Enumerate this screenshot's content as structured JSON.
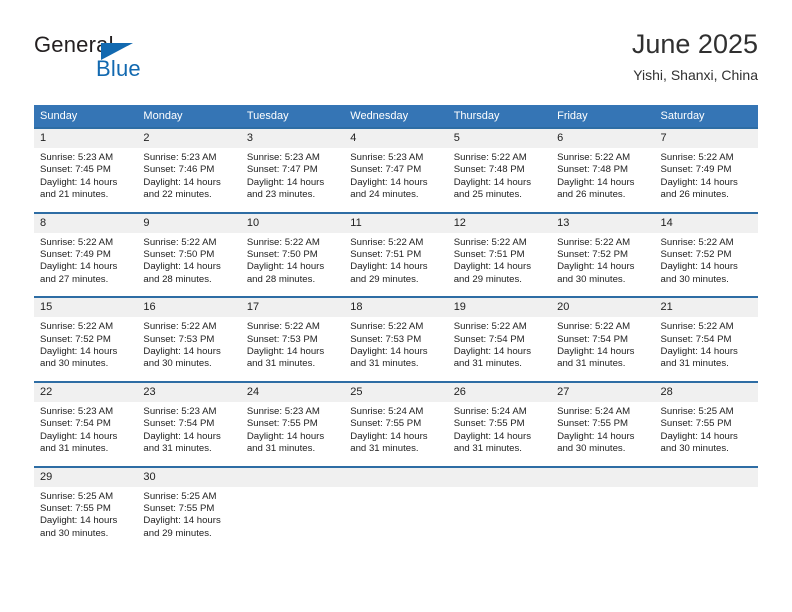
{
  "brand": {
    "name_top": "General",
    "name_bottom": "Blue",
    "triangle_color": "#1269b0"
  },
  "header": {
    "title": "June 2025",
    "location": "Yishi, Shanxi, China"
  },
  "colors": {
    "header_bg": "#3575b5",
    "header_text": "#ffffff",
    "daynum_bg": "#f0f0f0",
    "row_rule": "#2e6da4",
    "body_text": "#222222"
  },
  "weekday_headers": [
    "Sunday",
    "Monday",
    "Tuesday",
    "Wednesday",
    "Thursday",
    "Friday",
    "Saturday"
  ],
  "weeks": [
    [
      {
        "day": "1",
        "sunrise": "Sunrise: 5:23 AM",
        "sunset": "Sunset: 7:45 PM",
        "daylight1": "Daylight: 14 hours",
        "daylight2": "and 21 minutes."
      },
      {
        "day": "2",
        "sunrise": "Sunrise: 5:23 AM",
        "sunset": "Sunset: 7:46 PM",
        "daylight1": "Daylight: 14 hours",
        "daylight2": "and 22 minutes."
      },
      {
        "day": "3",
        "sunrise": "Sunrise: 5:23 AM",
        "sunset": "Sunset: 7:47 PM",
        "daylight1": "Daylight: 14 hours",
        "daylight2": "and 23 minutes."
      },
      {
        "day": "4",
        "sunrise": "Sunrise: 5:23 AM",
        "sunset": "Sunset: 7:47 PM",
        "daylight1": "Daylight: 14 hours",
        "daylight2": "and 24 minutes."
      },
      {
        "day": "5",
        "sunrise": "Sunrise: 5:22 AM",
        "sunset": "Sunset: 7:48 PM",
        "daylight1": "Daylight: 14 hours",
        "daylight2": "and 25 minutes."
      },
      {
        "day": "6",
        "sunrise": "Sunrise: 5:22 AM",
        "sunset": "Sunset: 7:48 PM",
        "daylight1": "Daylight: 14 hours",
        "daylight2": "and 26 minutes."
      },
      {
        "day": "7",
        "sunrise": "Sunrise: 5:22 AM",
        "sunset": "Sunset: 7:49 PM",
        "daylight1": "Daylight: 14 hours",
        "daylight2": "and 26 minutes."
      }
    ],
    [
      {
        "day": "8",
        "sunrise": "Sunrise: 5:22 AM",
        "sunset": "Sunset: 7:49 PM",
        "daylight1": "Daylight: 14 hours",
        "daylight2": "and 27 minutes."
      },
      {
        "day": "9",
        "sunrise": "Sunrise: 5:22 AM",
        "sunset": "Sunset: 7:50 PM",
        "daylight1": "Daylight: 14 hours",
        "daylight2": "and 28 minutes."
      },
      {
        "day": "10",
        "sunrise": "Sunrise: 5:22 AM",
        "sunset": "Sunset: 7:50 PM",
        "daylight1": "Daylight: 14 hours",
        "daylight2": "and 28 minutes."
      },
      {
        "day": "11",
        "sunrise": "Sunrise: 5:22 AM",
        "sunset": "Sunset: 7:51 PM",
        "daylight1": "Daylight: 14 hours",
        "daylight2": "and 29 minutes."
      },
      {
        "day": "12",
        "sunrise": "Sunrise: 5:22 AM",
        "sunset": "Sunset: 7:51 PM",
        "daylight1": "Daylight: 14 hours",
        "daylight2": "and 29 minutes."
      },
      {
        "day": "13",
        "sunrise": "Sunrise: 5:22 AM",
        "sunset": "Sunset: 7:52 PM",
        "daylight1": "Daylight: 14 hours",
        "daylight2": "and 30 minutes."
      },
      {
        "day": "14",
        "sunrise": "Sunrise: 5:22 AM",
        "sunset": "Sunset: 7:52 PM",
        "daylight1": "Daylight: 14 hours",
        "daylight2": "and 30 minutes."
      }
    ],
    [
      {
        "day": "15",
        "sunrise": "Sunrise: 5:22 AM",
        "sunset": "Sunset: 7:52 PM",
        "daylight1": "Daylight: 14 hours",
        "daylight2": "and 30 minutes."
      },
      {
        "day": "16",
        "sunrise": "Sunrise: 5:22 AM",
        "sunset": "Sunset: 7:53 PM",
        "daylight1": "Daylight: 14 hours",
        "daylight2": "and 30 minutes."
      },
      {
        "day": "17",
        "sunrise": "Sunrise: 5:22 AM",
        "sunset": "Sunset: 7:53 PM",
        "daylight1": "Daylight: 14 hours",
        "daylight2": "and 31 minutes."
      },
      {
        "day": "18",
        "sunrise": "Sunrise: 5:22 AM",
        "sunset": "Sunset: 7:53 PM",
        "daylight1": "Daylight: 14 hours",
        "daylight2": "and 31 minutes."
      },
      {
        "day": "19",
        "sunrise": "Sunrise: 5:22 AM",
        "sunset": "Sunset: 7:54 PM",
        "daylight1": "Daylight: 14 hours",
        "daylight2": "and 31 minutes."
      },
      {
        "day": "20",
        "sunrise": "Sunrise: 5:22 AM",
        "sunset": "Sunset: 7:54 PM",
        "daylight1": "Daylight: 14 hours",
        "daylight2": "and 31 minutes."
      },
      {
        "day": "21",
        "sunrise": "Sunrise: 5:22 AM",
        "sunset": "Sunset: 7:54 PM",
        "daylight1": "Daylight: 14 hours",
        "daylight2": "and 31 minutes."
      }
    ],
    [
      {
        "day": "22",
        "sunrise": "Sunrise: 5:23 AM",
        "sunset": "Sunset: 7:54 PM",
        "daylight1": "Daylight: 14 hours",
        "daylight2": "and 31 minutes."
      },
      {
        "day": "23",
        "sunrise": "Sunrise: 5:23 AM",
        "sunset": "Sunset: 7:54 PM",
        "daylight1": "Daylight: 14 hours",
        "daylight2": "and 31 minutes."
      },
      {
        "day": "24",
        "sunrise": "Sunrise: 5:23 AM",
        "sunset": "Sunset: 7:55 PM",
        "daylight1": "Daylight: 14 hours",
        "daylight2": "and 31 minutes."
      },
      {
        "day": "25",
        "sunrise": "Sunrise: 5:24 AM",
        "sunset": "Sunset: 7:55 PM",
        "daylight1": "Daylight: 14 hours",
        "daylight2": "and 31 minutes."
      },
      {
        "day": "26",
        "sunrise": "Sunrise: 5:24 AM",
        "sunset": "Sunset: 7:55 PM",
        "daylight1": "Daylight: 14 hours",
        "daylight2": "and 31 minutes."
      },
      {
        "day": "27",
        "sunrise": "Sunrise: 5:24 AM",
        "sunset": "Sunset: 7:55 PM",
        "daylight1": "Daylight: 14 hours",
        "daylight2": "and 30 minutes."
      },
      {
        "day": "28",
        "sunrise": "Sunrise: 5:25 AM",
        "sunset": "Sunset: 7:55 PM",
        "daylight1": "Daylight: 14 hours",
        "daylight2": "and 30 minutes."
      }
    ],
    [
      {
        "day": "29",
        "sunrise": "Sunrise: 5:25 AM",
        "sunset": "Sunset: 7:55 PM",
        "daylight1": "Daylight: 14 hours",
        "daylight2": "and 30 minutes."
      },
      {
        "day": "30",
        "sunrise": "Sunrise: 5:25 AM",
        "sunset": "Sunset: 7:55 PM",
        "daylight1": "Daylight: 14 hours",
        "daylight2": "and 29 minutes."
      },
      {
        "day": "",
        "sunrise": "",
        "sunset": "",
        "daylight1": "",
        "daylight2": ""
      },
      {
        "day": "",
        "sunrise": "",
        "sunset": "",
        "daylight1": "",
        "daylight2": ""
      },
      {
        "day": "",
        "sunrise": "",
        "sunset": "",
        "daylight1": "",
        "daylight2": ""
      },
      {
        "day": "",
        "sunrise": "",
        "sunset": "",
        "daylight1": "",
        "daylight2": ""
      },
      {
        "day": "",
        "sunrise": "",
        "sunset": "",
        "daylight1": "",
        "daylight2": ""
      }
    ]
  ]
}
